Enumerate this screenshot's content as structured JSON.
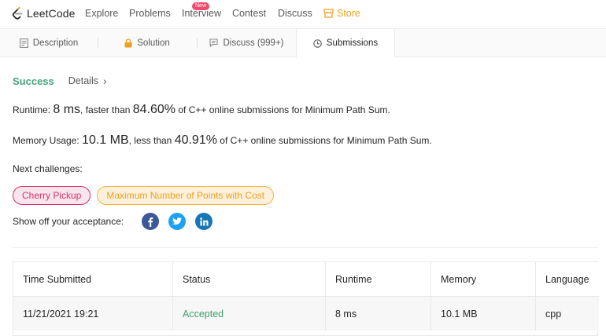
{
  "nav": {
    "logo_text": "LeetCode",
    "items": [
      "Explore",
      "Problems",
      "Interview",
      "Contest",
      "Discuss"
    ],
    "new_badge": "New",
    "store": "Store"
  },
  "tabs": {
    "description": "Description",
    "solution": "Solution",
    "discuss": "Discuss (999+)",
    "submissions": "Submissions",
    "active": "Submissions"
  },
  "result": {
    "status": "Success",
    "details": "Details",
    "details_chevron": "›",
    "runtime_prefix": "Runtime:",
    "runtime_value": "8 ms",
    "runtime_mid": ", faster than",
    "runtime_percent": "84.60%",
    "runtime_suffix": "of C++ online submissions for Minimum Path Sum.",
    "memory_prefix": "Memory Usage:",
    "memory_value": "10.1 MB",
    "memory_mid": ", less than",
    "memory_percent": "40.91%",
    "memory_suffix": "of C++ online submissions for Minimum Path Sum.",
    "next_label": "Next challenges:",
    "challenges": [
      {
        "label": "Cherry Pickup",
        "difficulty": "hard"
      },
      {
        "label": "Maximum Number of Points with Cost",
        "difficulty": "medium"
      }
    ],
    "share_label": "Show off your acceptance:",
    "share_icons": [
      "facebook-icon",
      "twitter-icon",
      "linkedin-icon"
    ]
  },
  "submissions": {
    "columns": [
      "Time Submitted",
      "Status",
      "Runtime",
      "Memory",
      "Language"
    ],
    "rows": [
      {
        "time": "11/21/2021 19:21",
        "status": "Accepted",
        "runtime": "8 ms",
        "memory": "10.1 MB",
        "language": "cpp"
      }
    ]
  },
  "colors": {
    "success": "#45a27c",
    "hard": "#d4336a",
    "medium": "#f0a020",
    "store": "#f0a020"
  }
}
